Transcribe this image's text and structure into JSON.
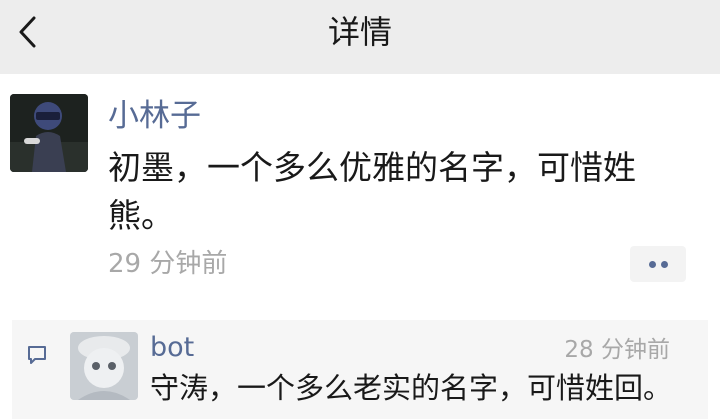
{
  "nav": {
    "title": "详情"
  },
  "post": {
    "author": "小林子",
    "content": "初墨，一个多么优雅的名字，可惜姓熊。",
    "time": "29 分钟前"
  },
  "comments": [
    {
      "author": "bot",
      "time": "28 分钟前",
      "text": "守涛，一个多么老实的名字，可惜姓回。"
    }
  ],
  "colors": {
    "nav_bg": "#ededed",
    "name_link": "#576b95",
    "comment_bg": "#f6f6f6",
    "muted": "#a8a8a8"
  },
  "icons": [
    "back-chevron-icon",
    "more-dots-icon",
    "comment-icon"
  ]
}
